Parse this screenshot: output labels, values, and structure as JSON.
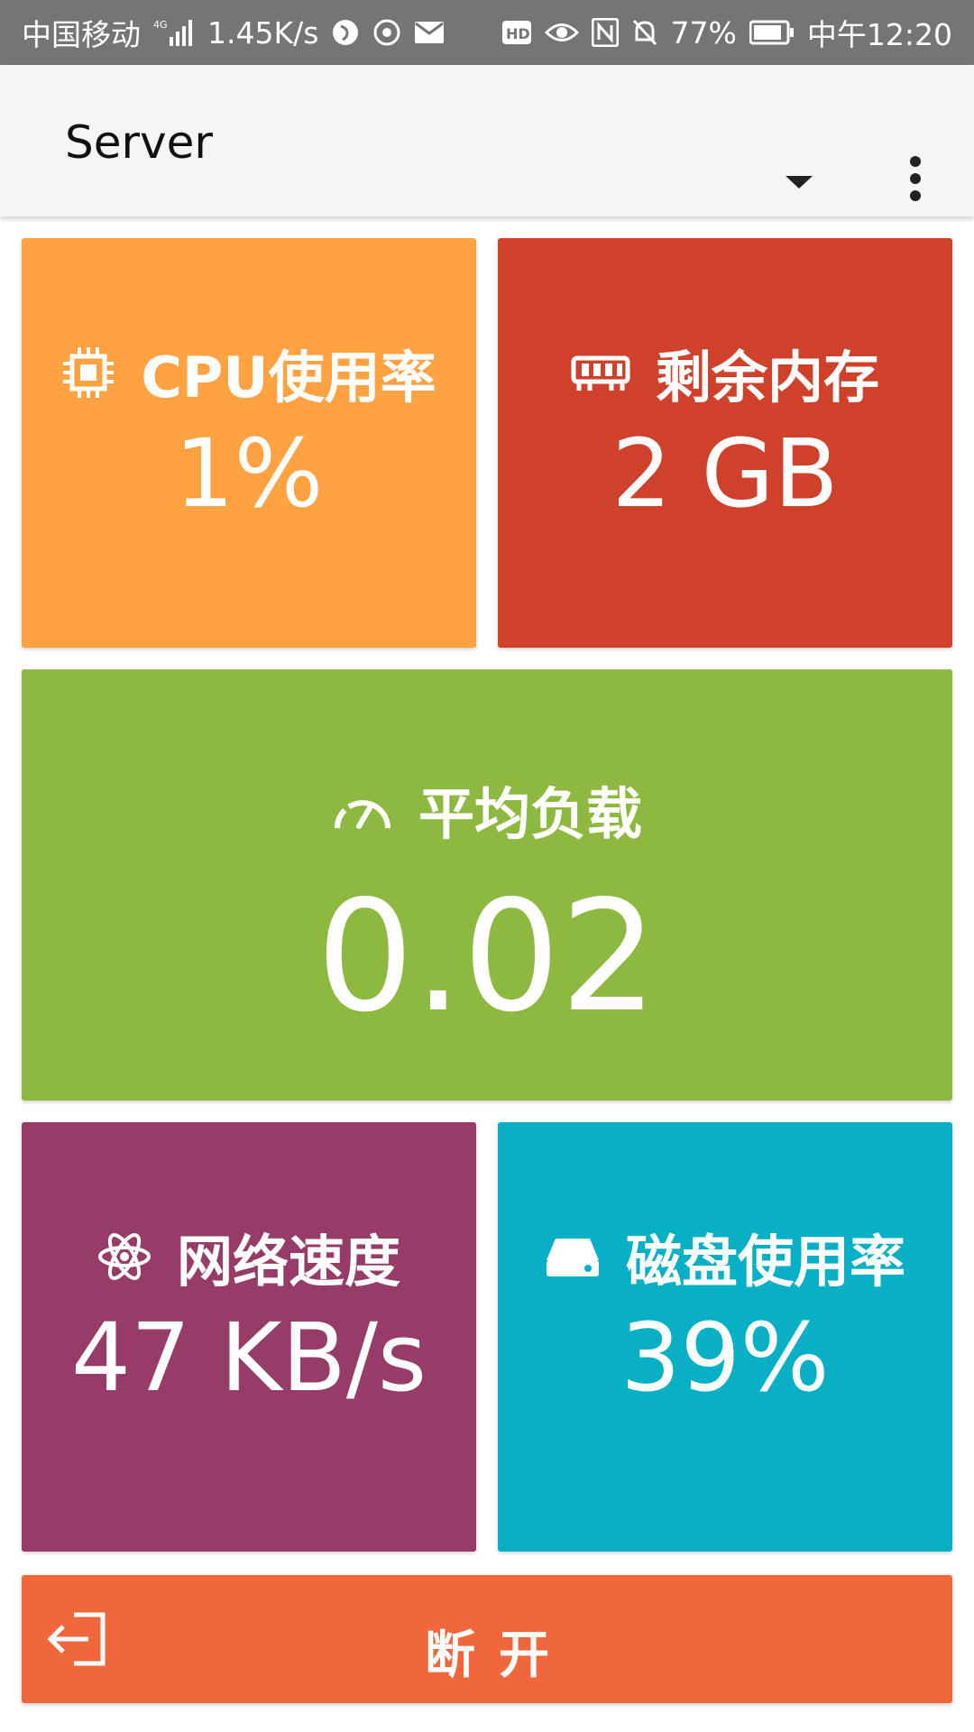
{
  "status_bar": {
    "carrier": "中国移动",
    "network_type": "4G",
    "speed": "1.45K/s",
    "battery": "77%",
    "time": "中午12:20"
  },
  "app_bar": {
    "title": "Server",
    "dropdown_icon": "arrow-drop-down-icon",
    "more_icon": "more-vert-icon"
  },
  "tiles": {
    "cpu": {
      "label": "CPU使用率",
      "value": "1%",
      "icon": "chip-icon",
      "color": "#ffa242"
    },
    "memory": {
      "label": "剩余内存",
      "value": "2 GB",
      "icon": "memory-icon",
      "color": "#d0412b"
    },
    "load": {
      "label": "平均负载",
      "value": "0.02",
      "icon": "speedometer-icon",
      "color": "#8db940"
    },
    "network": {
      "label": "网络速度",
      "value": "47 KB/s",
      "icon": "atom-icon",
      "color": "#973c68"
    },
    "disk": {
      "label": "磁盘使用率",
      "value": "39%",
      "icon": "harddisk-icon",
      "color": "#07b0c4"
    }
  },
  "disconnect": {
    "label": "断开",
    "icon": "exit-icon",
    "color": "#f0673c"
  }
}
